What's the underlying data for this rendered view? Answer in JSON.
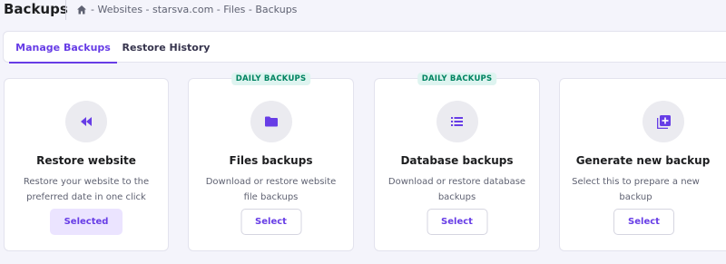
{
  "header": {
    "title": "Backups",
    "breadcrumb": {
      "home_icon": "home-icon",
      "path": "- Websites - starsva.com - Files - Backups"
    }
  },
  "tabs": [
    {
      "label": "Manage Backups",
      "active": true
    },
    {
      "label": "Restore History",
      "active": false
    }
  ],
  "cards": [
    {
      "icon": "rewind-icon",
      "badge": "",
      "title": "Restore website",
      "description": "Restore your website to the preferred date in one click",
      "button": "Selected"
    },
    {
      "icon": "folder-icon",
      "badge": "DAILY BACKUPS",
      "title": "Files backups",
      "description": "Download or restore website file backups",
      "button": "Select"
    },
    {
      "icon": "list-icon",
      "badge": "DAILY BACKUPS",
      "title": "Database backups",
      "description": "Download or restore database backups",
      "button": "Select"
    },
    {
      "icon": "add-stack-icon",
      "badge": "",
      "title": "Generate new backup",
      "description": "Select this to prepare a new backup",
      "button": "Select"
    }
  ],
  "colors": {
    "accent": "#673de6",
    "badge_bg": "#def4f0",
    "badge_text": "#008361",
    "selected_bg": "#ebe4ff",
    "page_bg": "#f4f4fb"
  }
}
